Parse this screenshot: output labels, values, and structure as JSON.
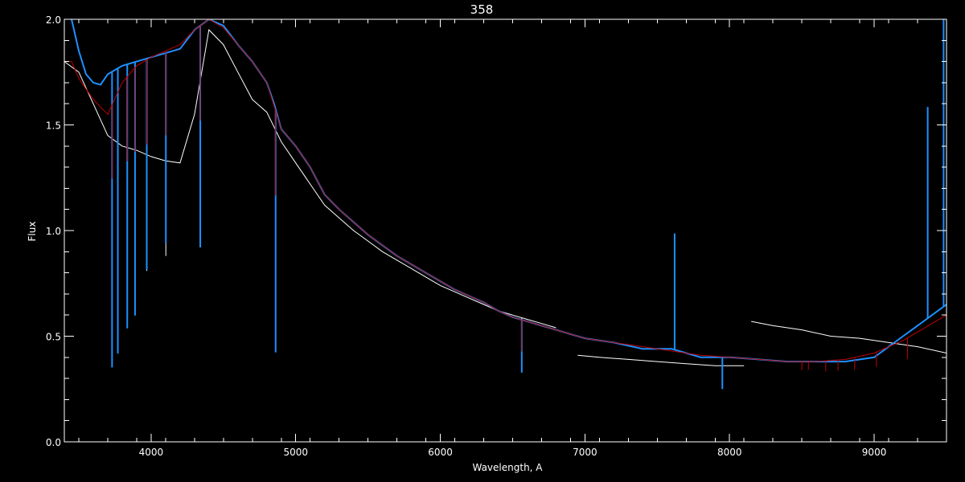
{
  "chart_data": {
    "type": "line",
    "title": "358",
    "xlabel": "Wavelength, A",
    "ylabel": "Flux",
    "xlim": [
      3400,
      9500
    ],
    "ylim": [
      0.0,
      2.0
    ],
    "x_ticks": [
      4000,
      5000,
      6000,
      7000,
      8000,
      9000
    ],
    "x_tick_labels": [
      "4000",
      "5000",
      "6000",
      "7000",
      "8000",
      "9000"
    ],
    "y_ticks": [
      0.0,
      0.5,
      1.0,
      1.5,
      2.0
    ],
    "y_tick_labels": [
      "0.0",
      "0.5",
      "1.0",
      "1.5",
      "2.0"
    ],
    "grid": false,
    "background": "#000000",
    "axis_color": "#ffffff",
    "series": [
      {
        "color": "#ffffff",
        "segments": [
          {
            "x": [
              3400,
              3500,
              3600,
              3700,
              3800,
              3900,
              4000,
              4100,
              4200,
              4300,
              4400,
              4500,
              4600,
              4700,
              4800,
              4900,
              5000,
              5100,
              5200,
              5300,
              5400,
              5500,
              5600,
              5700,
              5800,
              5900,
              6000,
              6100,
              6200,
              6300,
              6400,
              6500,
              6600,
              6700,
              6800
            ],
            "y": [
              1.8,
              1.75,
              1.6,
              1.45,
              1.4,
              1.38,
              1.35,
              1.33,
              1.32,
              1.55,
              1.95,
              1.88,
              1.75,
              1.62,
              1.56,
              1.42,
              1.32,
              1.22,
              1.12,
              1.06,
              1.0,
              0.95,
              0.9,
              0.86,
              0.82,
              0.78,
              0.74,
              0.71,
              0.68,
              0.65,
              0.62,
              0.6,
              0.58,
              0.56,
              0.54
            ]
          },
          {
            "x": [
              6950,
              7100,
              7300,
              7500,
              7700,
              7900,
              8100
            ],
            "y": [
              0.41,
              0.4,
              0.39,
              0.38,
              0.37,
              0.36,
              0.36
            ]
          },
          {
            "x": [
              8150,
              8300,
              8500,
              8700,
              8900,
              9100,
              9300,
              9500
            ],
            "y": [
              0.57,
              0.55,
              0.53,
              0.5,
              0.49,
              0.47,
              0.45,
              0.42
            ]
          }
        ],
        "absorption_lines": [
          {
            "x": 3730,
            "depth": 0.8
          },
          {
            "x": 3770,
            "depth": 0.8
          },
          {
            "x": 3835,
            "depth": 0.8
          },
          {
            "x": 3889,
            "depth": 0.75
          },
          {
            "x": 3970,
            "depth": 0.55
          },
          {
            "x": 4102,
            "depth": 0.45
          },
          {
            "x": 4340,
            "depth": 0.5
          },
          {
            "x": 4861,
            "depth": 0.9
          },
          {
            "x": 6563,
            "depth": 0.12
          }
        ]
      },
      {
        "color": "#1e90ff",
        "segments": [
          {
            "x": [
              3450,
              3500,
              3550,
              3600,
              3650,
              3700,
              3800,
              3900,
              4000,
              4100,
              4200,
              4300,
              4400,
              4500,
              4600,
              4700,
              4800,
              4850,
              4900,
              5000,
              5100,
              5200,
              5300,
              5400,
              5500,
              5600,
              5700,
              5800,
              5900,
              6000,
              6100,
              6200,
              6300,
              6400,
              6500,
              6600,
              6700,
              6800,
              6900,
              7000,
              7200,
              7400,
              7600,
              7700,
              7800,
              8000,
              8200,
              8400,
              8600,
              8800,
              9000,
              9100,
              9200,
              9300,
              9400,
              9500
            ],
            "y": [
              2.0,
              1.85,
              1.74,
              1.7,
              1.69,
              1.74,
              1.78,
              1.8,
              1.82,
              1.84,
              1.86,
              1.95,
              2.0,
              1.97,
              1.88,
              1.8,
              1.7,
              1.6,
              1.48,
              1.4,
              1.3,
              1.17,
              1.1,
              1.04,
              0.98,
              0.93,
              0.88,
              0.84,
              0.8,
              0.76,
              0.72,
              0.69,
              0.66,
              0.62,
              0.59,
              0.57,
              0.55,
              0.53,
              0.51,
              0.49,
              0.47,
              0.44,
              0.44,
              0.42,
              0.4,
              0.4,
              0.39,
              0.38,
              0.38,
              0.38,
              0.4,
              0.45,
              0.5,
              0.55,
              0.6,
              0.65
            ]
          }
        ],
        "absorption_lines": [
          {
            "x": 3730,
            "depth": 1.4
          },
          {
            "x": 3770,
            "depth": 1.35
          },
          {
            "x": 3835,
            "depth": 1.25
          },
          {
            "x": 3889,
            "depth": 1.2
          },
          {
            "x": 3970,
            "depth": 1.0
          },
          {
            "x": 4102,
            "depth": 0.9
          },
          {
            "x": 4340,
            "depth": 1.05
          },
          {
            "x": 4861,
            "depth": 1.15
          },
          {
            "x": 6563,
            "depth": 0.25
          },
          {
            "x": 7950,
            "depth": 0.15
          }
        ],
        "emission_spikes": [
          {
            "x": 7620,
            "height": 0.55
          },
          {
            "x": 9370,
            "height": 1.0
          },
          {
            "x": 9480,
            "height": 1.45
          }
        ]
      },
      {
        "color": "#c00000",
        "segments": [
          {
            "x": [
              3400,
              3450,
              3500,
              3600,
              3700,
              3800,
              3900,
              4000,
              4100,
              4200,
              4300,
              4400,
              4500,
              4600,
              4700,
              4800,
              4900,
              5000,
              5100,
              5200,
              5300,
              5400,
              5500,
              5600,
              5700,
              5800,
              5900,
              6000,
              6100,
              6200,
              6300,
              6400,
              6500,
              6600,
              6700,
              6800,
              6900,
              7000,
              7200,
              7400,
              7600,
              7800,
              8000,
              8200,
              8400,
              8600,
              8800,
              9000,
              9200,
              9400,
              9500
            ],
            "y": [
              1.8,
              1.8,
              1.72,
              1.62,
              1.55,
              1.7,
              1.78,
              1.82,
              1.85,
              1.88,
              1.95,
              2.0,
              1.96,
              1.88,
              1.8,
              1.7,
              1.48,
              1.4,
              1.3,
              1.17,
              1.1,
              1.04,
              0.98,
              0.93,
              0.88,
              0.84,
              0.8,
              0.76,
              0.72,
              0.69,
              0.66,
              0.62,
              0.59,
              0.57,
              0.55,
              0.53,
              0.51,
              0.49,
              0.47,
              0.45,
              0.43,
              0.41,
              0.4,
              0.39,
              0.38,
              0.38,
              0.39,
              0.42,
              0.48,
              0.56,
              0.6
            ]
          }
        ],
        "absorption_lines": [
          {
            "x": 3730,
            "depth": 0.35
          },
          {
            "x": 3835,
            "depth": 0.4
          },
          {
            "x": 3889,
            "depth": 0.4
          },
          {
            "x": 3970,
            "depth": 0.4
          },
          {
            "x": 4102,
            "depth": 0.4
          },
          {
            "x": 4340,
            "depth": 0.45
          },
          {
            "x": 4861,
            "depth": 0.4
          },
          {
            "x": 6563,
            "depth": 0.15
          },
          {
            "x": 8500,
            "depth": 0.04
          },
          {
            "x": 8545,
            "depth": 0.04
          },
          {
            "x": 8665,
            "depth": 0.05
          },
          {
            "x": 8750,
            "depth": 0.05
          },
          {
            "x": 8865,
            "depth": 0.06
          },
          {
            "x": 9015,
            "depth": 0.07
          },
          {
            "x": 9230,
            "depth": 0.1
          }
        ]
      }
    ]
  }
}
